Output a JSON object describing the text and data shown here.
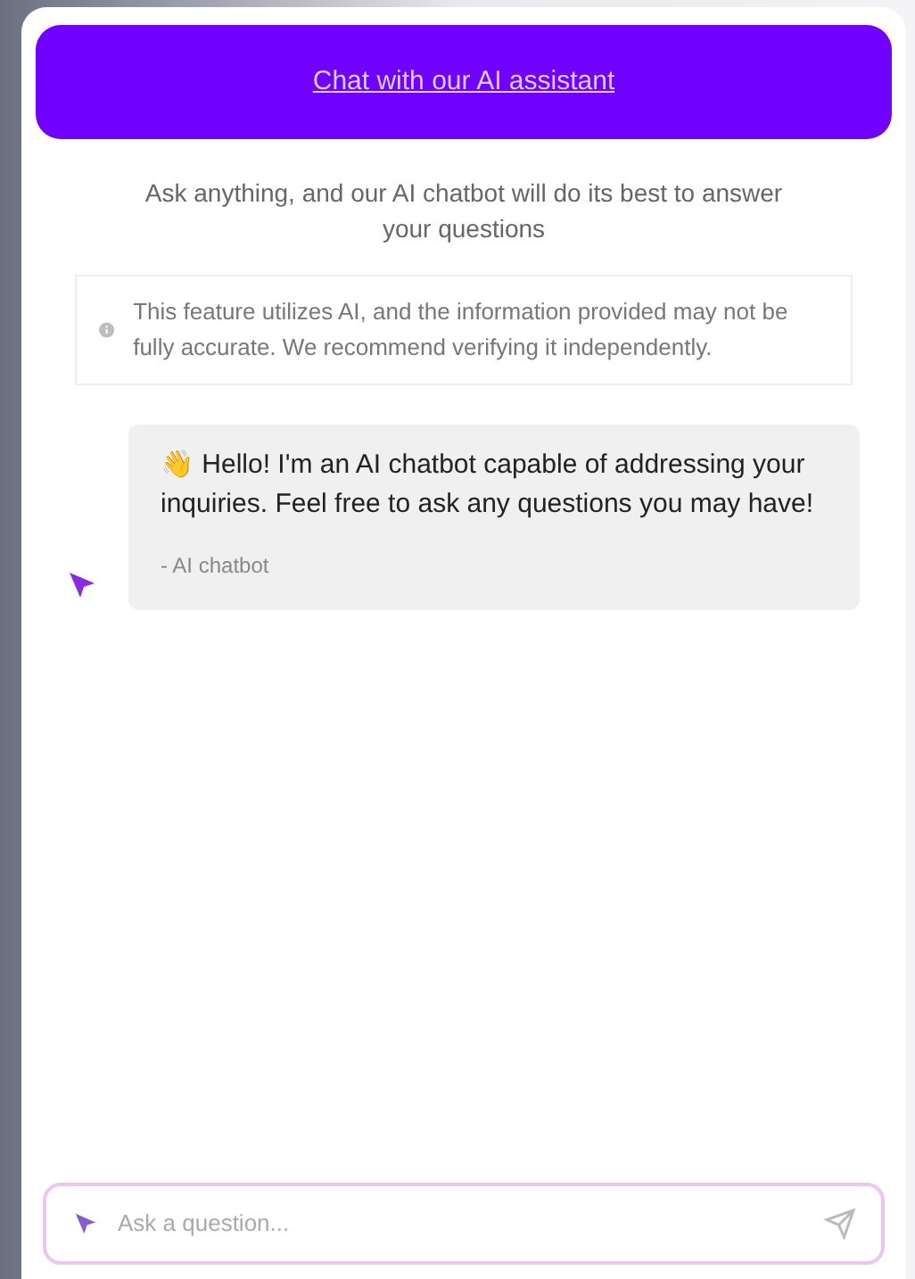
{
  "header": {
    "title": "Chat with our AI assistant"
  },
  "intro": "Ask anything, and our AI chatbot will do its best to answer your questions",
  "notice": "This feature utilizes AI, and the information provided may not be fully accurate. We recommend verifying it independently.",
  "messages": [
    {
      "emoji": "👋",
      "text": "Hello! I'm an AI chatbot capable of addressing your inquiries. Feel free to ask any questions you may have!",
      "signature": "- AI chatbot"
    }
  ],
  "composer": {
    "placeholder": "Ask a question..."
  }
}
